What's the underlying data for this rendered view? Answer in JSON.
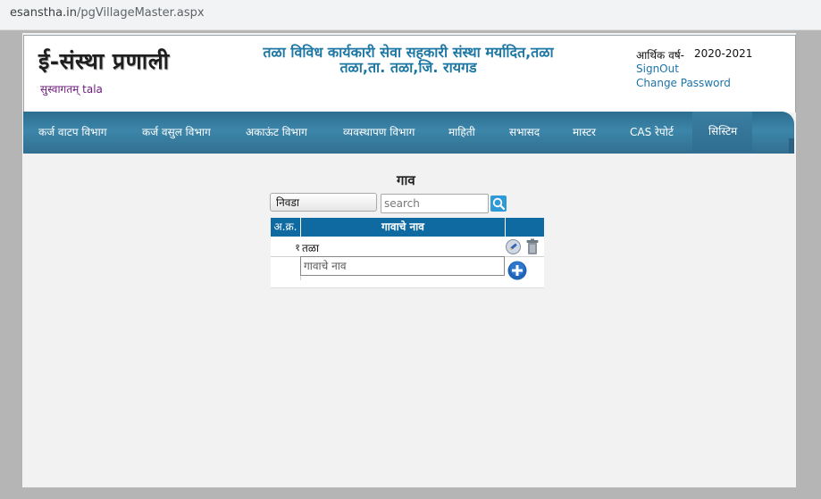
{
  "browser": {
    "url_host": "esanstha.in",
    "url_path": "/pgVillageMaster.aspx"
  },
  "header": {
    "logo_text": "ई-संस्था प्रणाली",
    "welcome": "सुस्वागतम् tala",
    "org_line1": "तळा विविध कार्यकारी सेवा सहकारी संस्था मर्यादित,तळा",
    "org_line2": "तळा,ता. तळा,जि. रायगड",
    "fy_label": "आर्थिक वर्ष-",
    "fy_value": "2020-2021",
    "signout": "SignOut",
    "change_password": "Change Password"
  },
  "nav": {
    "items": [
      "कर्ज वाटप विभाग",
      "कर्ज वसुल विभाग",
      "अकाऊंट विभाग",
      "व्यवस्थापण विभाग",
      "माहिती",
      "सभासद",
      "मास्टर",
      "CAS रेपोर्ट",
      "सिस्टिम"
    ]
  },
  "content": {
    "title": "गाव",
    "select_value": "निवडा",
    "search_placeholder": "search",
    "grid": {
      "headers": [
        "अ.क्र.",
        "गावाचे नाव"
      ],
      "rows": [
        {
          "sno": "१",
          "name": "तळा"
        }
      ],
      "new_placeholder": "गावाचे नाव"
    }
  },
  "colors": {
    "nav_bg": "#2d6e90",
    "grid_header_bg": "#0e6aa0",
    "org_title": "#1f78a4",
    "link": "#1c74a8",
    "welcome": "#6b1a7a"
  },
  "icons": {
    "search": "search-icon",
    "edit": "edit-icon",
    "delete": "trash-icon",
    "add": "plus-circle-icon"
  }
}
